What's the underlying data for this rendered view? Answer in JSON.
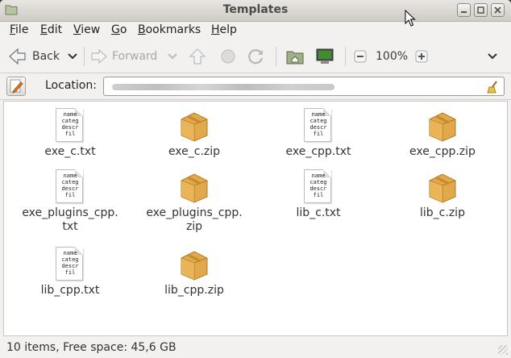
{
  "window": {
    "title": "Templates"
  },
  "menubar": {
    "items": [
      {
        "label": "File",
        "mnemonic": "F",
        "rest": "ile"
      },
      {
        "label": "Edit",
        "mnemonic": "E",
        "rest": "dit"
      },
      {
        "label": "View",
        "mnemonic": "V",
        "rest": "iew"
      },
      {
        "label": "Go",
        "mnemonic": "G",
        "rest": "o"
      },
      {
        "label": "Bookmarks",
        "mnemonic": "B",
        "rest": "ookmarks"
      },
      {
        "label": "Help",
        "mnemonic": "H",
        "rest": "elp"
      }
    ]
  },
  "toolbar": {
    "back_label": "Back",
    "forward_label": "Forward",
    "zoom_level": "100%"
  },
  "location": {
    "label": "Location:"
  },
  "files": [
    {
      "name_line1": "exe_c.txt",
      "name_line2": "",
      "type": "text"
    },
    {
      "name_line1": "exe_c.zip",
      "name_line2": "",
      "type": "archive"
    },
    {
      "name_line1": "exe_cpp.txt",
      "name_line2": "",
      "type": "text"
    },
    {
      "name_line1": "exe_cpp.zip",
      "name_line2": "",
      "type": "archive"
    },
    {
      "name_line1": "exe_plugins_cpp.",
      "name_line2": "txt",
      "type": "text"
    },
    {
      "name_line1": "exe_plugins_cpp.",
      "name_line2": "zip",
      "type": "archive"
    },
    {
      "name_line1": "lib_c.txt",
      "name_line2": "",
      "type": "text"
    },
    {
      "name_line1": "lib_c.zip",
      "name_line2": "",
      "type": "archive"
    },
    {
      "name_line1": "lib_cpp.txt",
      "name_line2": "",
      "type": "text"
    },
    {
      "name_line1": "lib_cpp.zip",
      "name_line2": "",
      "type": "archive"
    }
  ],
  "text_preview": "name\ncateg\ndescr\nfil",
  "statusbar": {
    "text": "10 items, Free space: 45,6 GB"
  },
  "colors": {
    "titlebar": "#dcdad5",
    "background": "#f2f1f0",
    "box_tan": "#e2a94b",
    "box_dark": "#b07a2a"
  }
}
